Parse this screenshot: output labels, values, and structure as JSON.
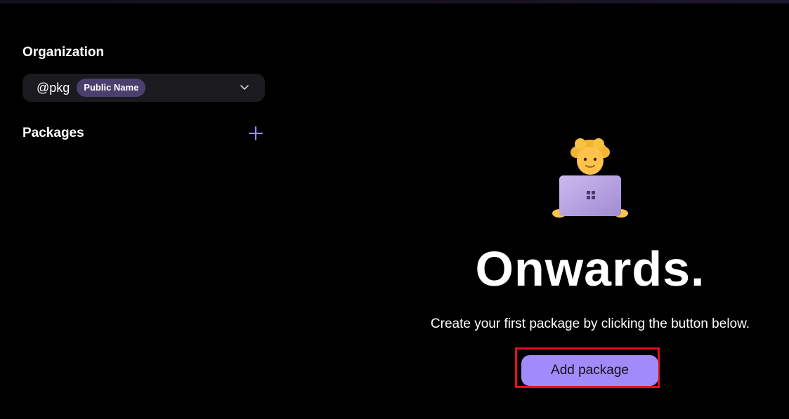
{
  "sidebar": {
    "organization_title": "Organization",
    "org_select": {
      "handle": "@pkg",
      "badge": "Public Name",
      "chevron_icon": "chevron-down-icon"
    },
    "packages_title": "Packages",
    "add_icon": "plus-icon"
  },
  "empty_state": {
    "illustration_icon": "person-with-laptop-icon",
    "headline": "Onwards.",
    "description": "Create your first package by clicking the button below.",
    "button_label": "Add package"
  },
  "colors": {
    "accent": "#a18bfa",
    "badge_bg": "#4a3f6e",
    "select_bg": "#1b1b1f",
    "highlight": "#e0111b"
  }
}
